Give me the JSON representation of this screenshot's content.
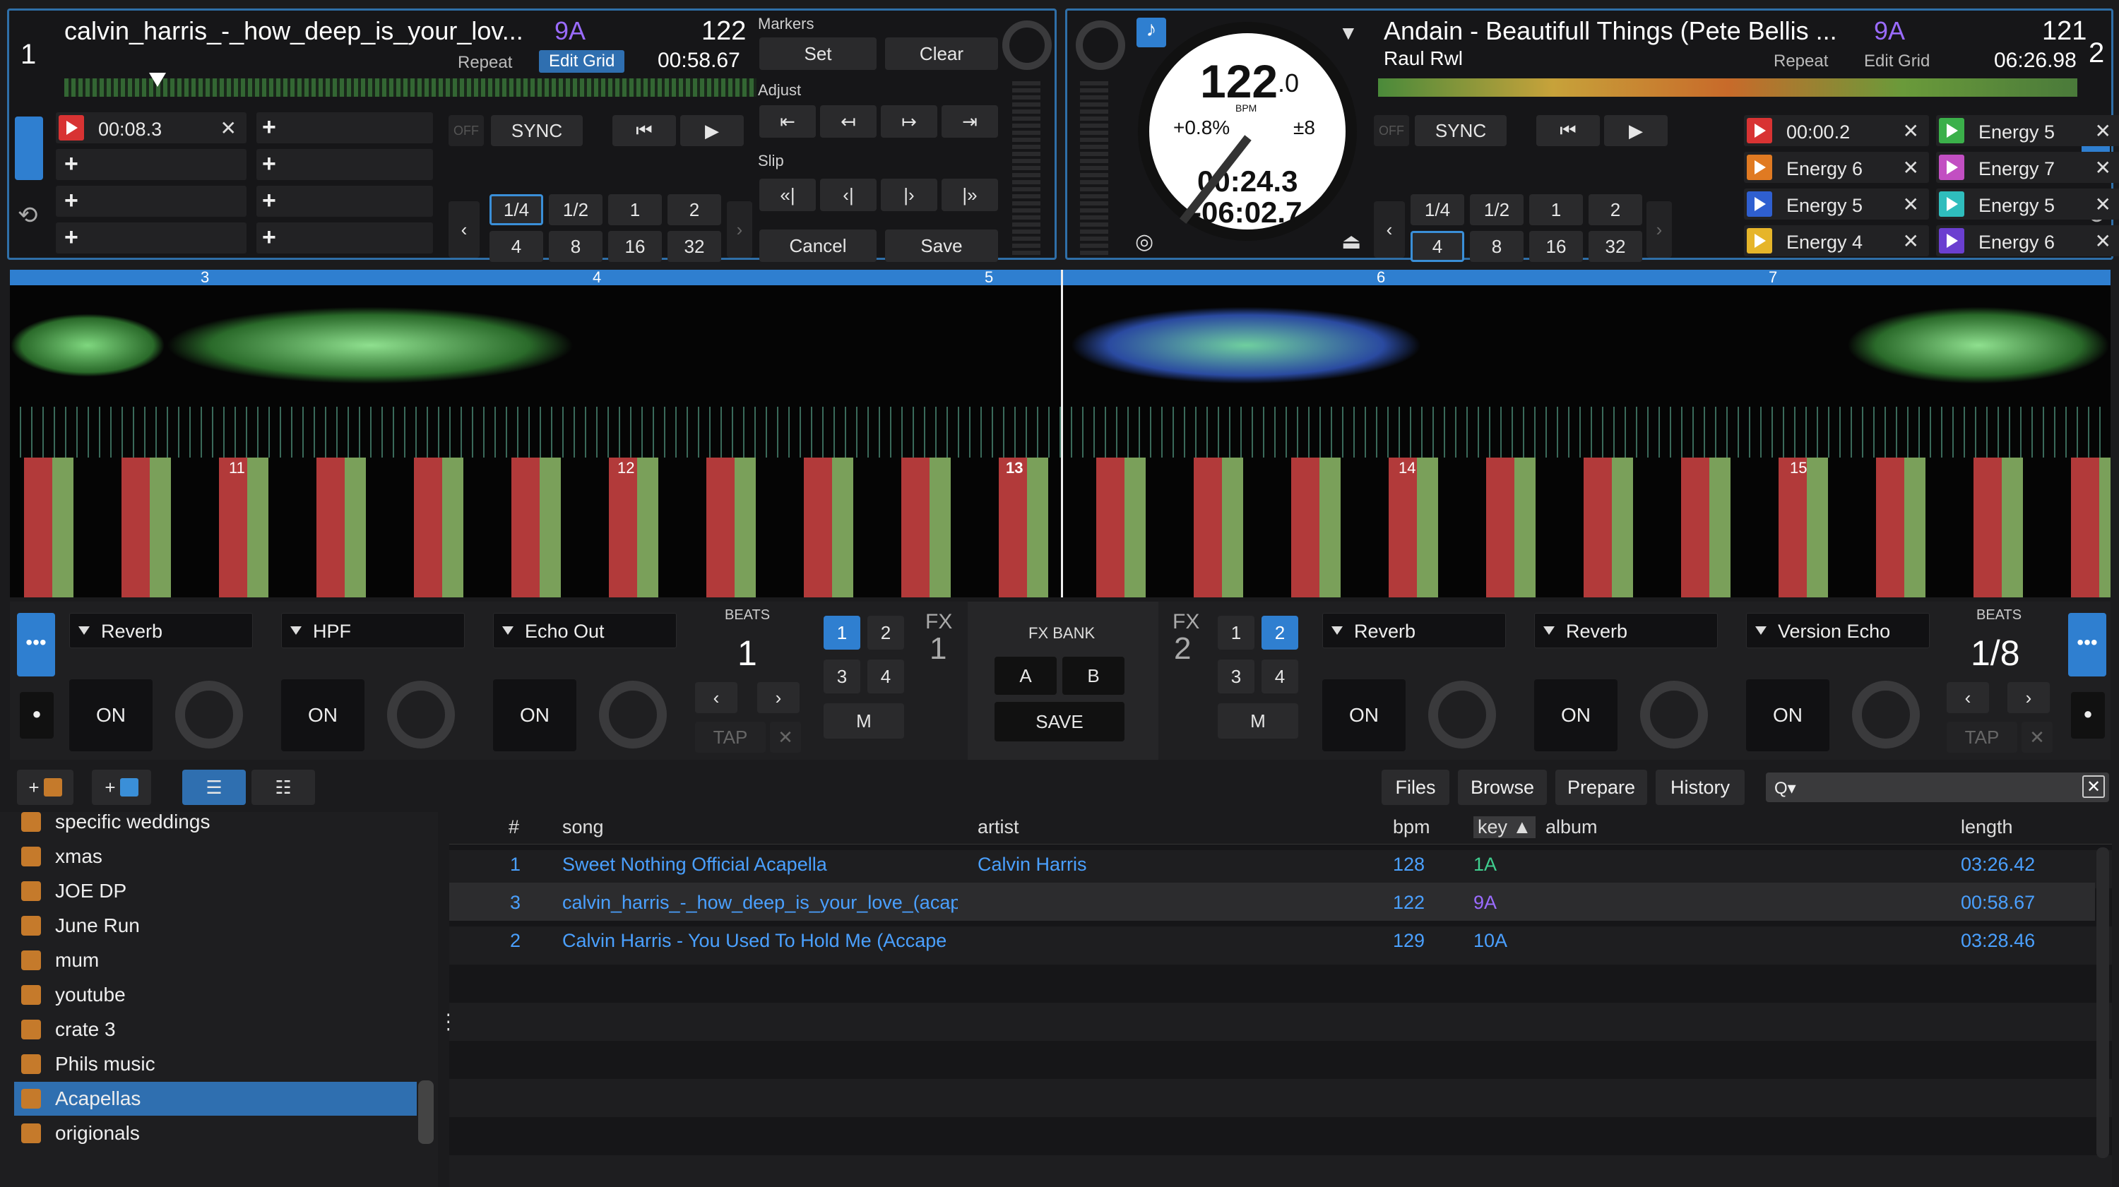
{
  "deck1": {
    "number": "1",
    "title": "calvin_harris_-_how_deep_is_your_lov...",
    "key": "9A",
    "bpm": "122",
    "repeat": "Repeat",
    "edit_grid": "Edit Grid",
    "time": "00:58.67",
    "cue1": "00:08.3",
    "sync": "SYNC",
    "off": "OFF",
    "loops": [
      "1/4",
      "1/2",
      "1",
      "2",
      "4",
      "8",
      "16",
      "32"
    ]
  },
  "markers": {
    "title": "Markers",
    "set": "Set",
    "clear": "Clear",
    "adjust": "Adjust",
    "slip": "Slip",
    "cancel": "Cancel",
    "save": "Save"
  },
  "deck2": {
    "number": "2",
    "title": "Andain - Beautifull Things (Pete Bellis ...",
    "key": "9A",
    "bpm": "121",
    "artist": "Raul Rwl",
    "repeat": "Repeat",
    "edit_grid": "Edit Grid",
    "time": "06:26.98",
    "platter_bpm": "122",
    "platter_bpm_dec": ".0",
    "bpm_unit": "BPM",
    "pitch": "+0.8%",
    "range": "±8",
    "elapsed": "00:24.3",
    "remain": "-06:02.7",
    "sync": "SYNC",
    "off": "OFF",
    "loops": [
      "1/4",
      "1/2",
      "1",
      "2",
      "4",
      "8",
      "16",
      "32"
    ],
    "cues": [
      {
        "label": "00:00.2",
        "color": "#d83333"
      },
      {
        "label": "Energy 5",
        "color": "#3bb04a"
      },
      {
        "label": "Energy 6",
        "color": "#e07a22"
      },
      {
        "label": "Energy 7",
        "color": "#c24fc2"
      },
      {
        "label": "Energy 5",
        "color": "#2f5fd0"
      },
      {
        "label": "Energy 5",
        "color": "#2fbdbd"
      },
      {
        "label": "Energy 4",
        "color": "#e6b52a"
      },
      {
        "label": "Energy 6",
        "color": "#6b3fd0"
      }
    ]
  },
  "waveform": {
    "top_beats": [
      "3",
      "4",
      "5",
      "6",
      "7"
    ],
    "bottom_beats": [
      "11",
      "12",
      "13",
      "14",
      "15"
    ]
  },
  "fx1": {
    "effects": [
      "Reverb",
      "HPF",
      "Echo Out"
    ],
    "on": "ON",
    "beats_label": "BEATS",
    "beats": "1",
    "fx": "FX",
    "num": "1",
    "slots": [
      "1",
      "2",
      "3",
      "4"
    ],
    "m": "M",
    "tap": "TAP"
  },
  "fxbank": {
    "title": "FX BANK",
    "a": "A",
    "b": "B",
    "save": "SAVE"
  },
  "fx2": {
    "effects": [
      "Reverb",
      "Reverb",
      "Version Echo"
    ],
    "on": "ON",
    "beats_label": "BEATS",
    "beats": "1/8",
    "fx": "FX",
    "num": "2",
    "slots": [
      "1",
      "2",
      "3",
      "4"
    ],
    "m": "M",
    "tap": "TAP"
  },
  "browser": {
    "tabs": [
      "Files",
      "Browse",
      "Prepare",
      "History"
    ],
    "search_placeholder": "Q▾",
    "columns": [
      "#",
      "song",
      "artist",
      "bpm",
      "key ▲",
      "album",
      "length"
    ],
    "rows": [
      {
        "n": "1",
        "song": "Sweet Nothing Official Acapella",
        "artist": "Calvin Harris",
        "bpm": "128",
        "key": "1A",
        "album": "",
        "length": "03:26.42",
        "keycolor": "#3fcf8f"
      },
      {
        "n": "3",
        "song": "calvin_harris_-_how_deep_is_your_love_(acap",
        "artist": "",
        "bpm": "122",
        "key": "9A",
        "album": "",
        "length": "00:58.67",
        "keycolor": "#9a6bff"
      },
      {
        "n": "2",
        "song": "Calvin Harris - You Used To Hold Me (Accape",
        "artist": "",
        "bpm": "129",
        "key": "10A",
        "album": "",
        "length": "03:28.46",
        "keycolor": "#4aa0ff"
      }
    ],
    "sidebar": [
      "specific weddings",
      "xmas",
      "JOE DP",
      "June Run",
      "mum",
      "youtube",
      "crate 3",
      "Phils music",
      "Acapellas",
      "origionals"
    ]
  }
}
